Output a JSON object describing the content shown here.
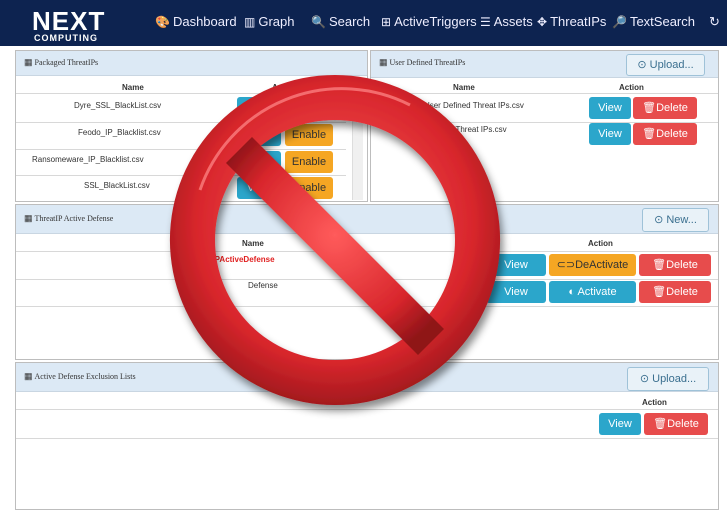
{
  "nav": {
    "logo_text_main": "NEXT",
    "logo_text_sub": "COMPUTING",
    "items": [
      {
        "label": "Dashboard",
        "icon": "palette-icon"
      },
      {
        "label": "Graph",
        "icon": "bar-chart-icon"
      },
      {
        "label": "Search",
        "icon": "search-icon"
      },
      {
        "label": "ActiveTriggers",
        "icon": "plus-square-icon"
      },
      {
        "label": "Assets",
        "icon": "list-icon"
      },
      {
        "label": "ThreatIPs",
        "icon": "crosshair-icon"
      },
      {
        "label": "TextSearch",
        "icon": "text-search-icon"
      }
    ]
  },
  "packaged": {
    "title": "Packaged ThreatIPs",
    "col_name": "Name",
    "col_action": "Action",
    "rows": [
      {
        "name": "Dyre_SSL_BlackList.csv",
        "view": "View",
        "toggle": "Enable"
      },
      {
        "name": "Feodo_IP_Blacklist.csv",
        "view": "View",
        "toggle": "Enable"
      },
      {
        "name": "Ransomeware_IP_Blacklist.csv",
        "view": "View",
        "toggle": "Enable"
      },
      {
        "name": "SSL_BlackList.csv",
        "view": "View",
        "toggle": "Enable"
      }
    ]
  },
  "user_defined": {
    "title": "User Defined ThreatIPs",
    "upload_label": "Upload...",
    "col_name": "Name",
    "col_action": "Action",
    "rows": [
      {
        "name": "1871865371_User Defined Threat IPs.csv",
        "view": "View",
        "delete": "Delete"
      },
      {
        "name": "...982_Threat IPs.csv",
        "view": "View",
        "delete": "Delete"
      }
    ]
  },
  "active_defense": {
    "title": "ThreatIP Active Defense",
    "new_label": "New...",
    "col_name": "Name",
    "col_action": "Action",
    "rows": [
      {
        "name": "ThreatIPActiveDefense",
        "view": "View",
        "toggle": "DeActivate",
        "delete": "Delete",
        "highlight": true
      },
      {
        "name": "Defense",
        "view": "View",
        "toggle": "Activate",
        "delete": "Delete",
        "highlight": false
      }
    ]
  },
  "exclusion": {
    "title": "Active Defense Exclusion Lists",
    "upload_label": "Upload...",
    "col_action": "Action",
    "rows": [
      {
        "view": "View",
        "delete": "Delete"
      }
    ]
  },
  "colors": {
    "nav_bg": "#0d2350",
    "view_btn": "#2ba6cb",
    "delete_btn": "#e74c4c",
    "enable_btn": "#f5a623",
    "prohibition_sign": "#d8262c"
  }
}
